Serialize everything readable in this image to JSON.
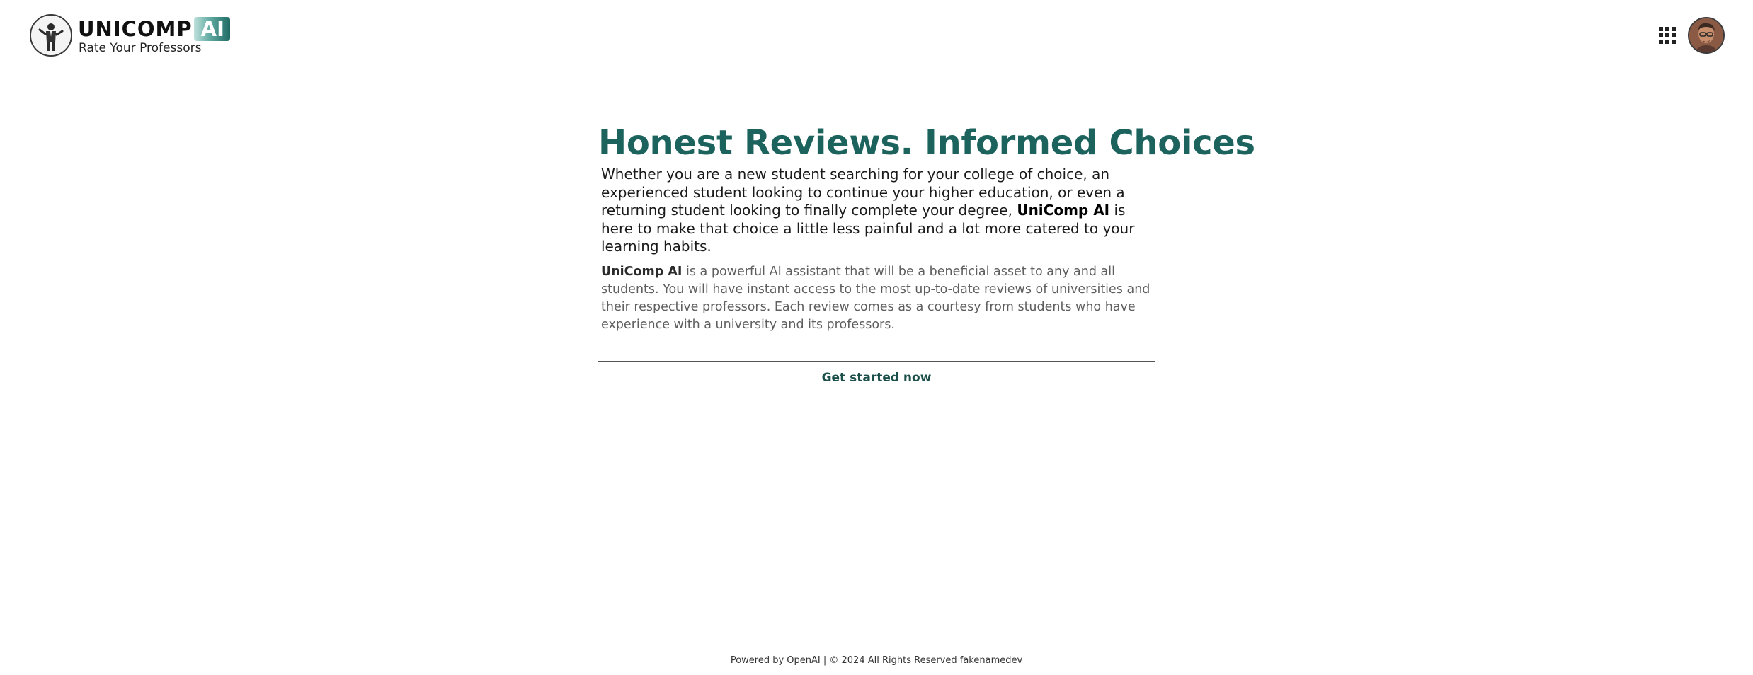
{
  "header": {
    "brand": {
      "name_main": "UNICOMP",
      "name_accent": "AI",
      "tagline": "Rate Your Professors",
      "logo_icon": "professor-figure-icon"
    },
    "apps_icon": "grid-apps-icon",
    "avatar_icon": "user-avatar"
  },
  "hero": {
    "headline": "Honest Reviews. Informed Choices",
    "lead": {
      "before": "Whether you are a new student searching for your college of choice, an experienced student looking to continue your higher education, or even a returning student looking to finally complete your degree, ",
      "brand": "UniComp AI",
      "after": " is here to make that choice a little less painful and a lot more catered to your learning habits."
    },
    "description": {
      "brand": "UniComp AI",
      "text": " is a powerful AI assistant that will be a beneficial asset to any and all students. You will have instant access to the most up-to-date reviews of universities and their respective professors. Each review comes as a courtesy from students who have experience with a university and its professors."
    },
    "cta_label": "Get started now"
  },
  "footer": {
    "text": "Powered by OpenAI | © 2024 All Rights Reserved fakenamedev"
  },
  "colors": {
    "headline": "#1b635c",
    "accent_gradient_end": "#1f6b64",
    "cta": "#1b4f49"
  }
}
